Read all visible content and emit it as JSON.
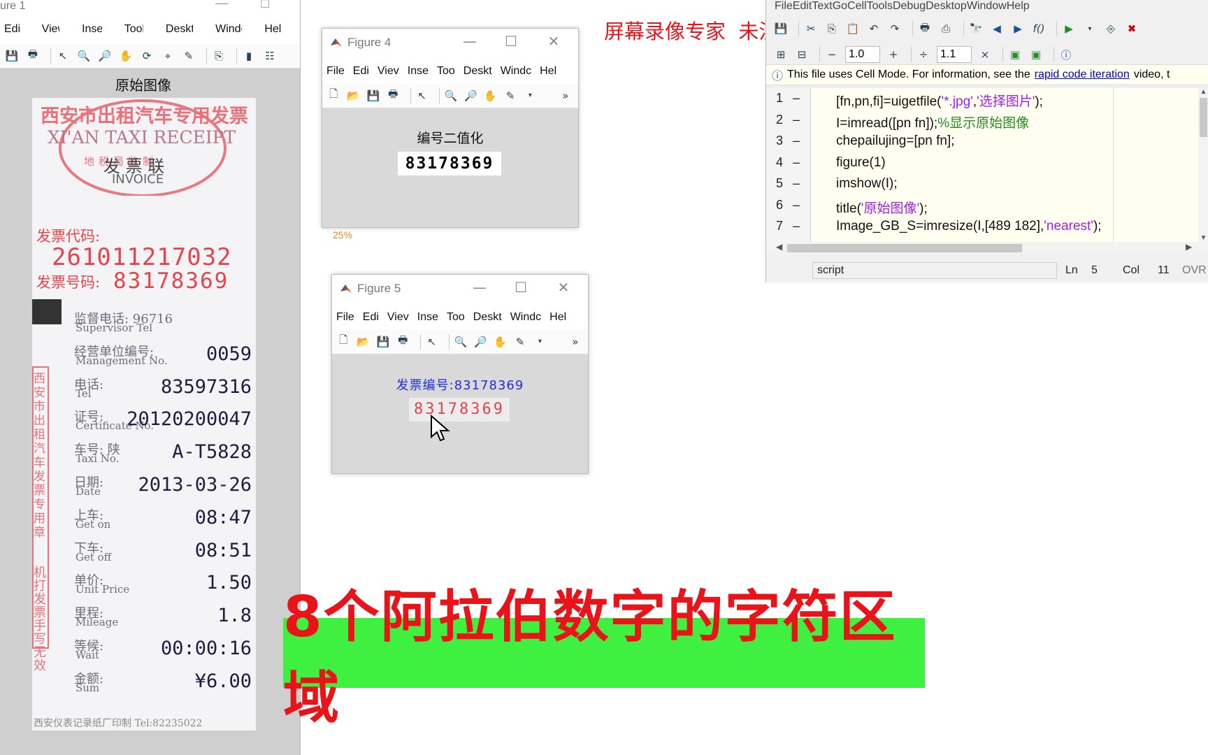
{
  "fig1": {
    "title": "ure 1",
    "menu": [
      "Edit",
      "View",
      "Insert",
      "Tools",
      "Desktop",
      "Window",
      "Help"
    ],
    "axes_title": "原始图像",
    "receipt": {
      "header_cn": "西安市出租汽车专用发票",
      "header_en": "XI'AN TAXI RECEIPT",
      "stamp_text": "地税局监制",
      "stub": "发 票 联",
      "invoice": "INVOICE",
      "code_label": "发票代码:",
      "code_value": "261011217032",
      "number_label": "发票号码:",
      "number_value": "83178369",
      "side_stamp": "西安市出租汽车发票专用章",
      "handwrite_note": "机打发票 手写无效",
      "footer": "西安仪表记录纸厂印制 Tel:82235022",
      "rows": [
        {
          "cn": "监督电话: 96716",
          "en": "Supervisor Tel",
          "value": ""
        },
        {
          "cn": "经营单位编号:",
          "en": "Management No.",
          "value": "0059"
        },
        {
          "cn": "电话:",
          "en": "Tel",
          "value": "83597316"
        },
        {
          "cn": "证号:",
          "en": "Certificate No.",
          "value": "20120200047"
        },
        {
          "cn": "车号: 陕",
          "en": "Taxi No.",
          "value": "A-T5828"
        },
        {
          "cn": "日期:",
          "en": "Date",
          "value": "2013-03-26"
        },
        {
          "cn": "上车:",
          "en": "Get on",
          "value": "08:47"
        },
        {
          "cn": "下车:",
          "en": "Get off",
          "value": "08:51"
        },
        {
          "cn": "单价:",
          "en": "Unit Price",
          "value": "1.50"
        },
        {
          "cn": "里程:",
          "en": "Mileage",
          "value": "1.8"
        },
        {
          "cn": "等候:",
          "en": "Wait",
          "value": "00:00:16"
        },
        {
          "cn": "金额:",
          "en": "Sum",
          "value": "¥6.00"
        }
      ]
    }
  },
  "fig4": {
    "title": "Figure 4",
    "menu": [
      "File",
      "Edi",
      "Viev",
      "Inse",
      "Too",
      "Deskt",
      "Windc",
      "Hel"
    ],
    "axes_title": "编号二值化",
    "image_text": "83178369"
  },
  "stray_label": "25%",
  "fig5": {
    "title": "Figure 5",
    "menu": [
      "File",
      "Edi",
      "Viev",
      "Inse",
      "Too",
      "Deskt",
      "Windc",
      "Hel"
    ],
    "axes_title": "发票编号:83178369",
    "image_text": "83178369"
  },
  "watermark": "屏幕录像专家  未注册",
  "editor": {
    "menu": [
      "File",
      "Edit",
      "Text",
      "Go",
      "Cell",
      "Tools",
      "Debug",
      "Desktop",
      "Window",
      "Help"
    ],
    "cell_minus_value": "1.0",
    "cell_div_value": "1.1",
    "info_text": "This file uses Cell Mode. For information, see the",
    "info_link": "rapid code iteration",
    "info_tail": "video, t",
    "lines": [
      {
        "n": "1",
        "parts": [
          [
            "[fn,pn,fi]=uigetfile(",
            ""
          ],
          [
            "'*.jpg'",
            "s"
          ],
          [
            ",",
            ""
          ],
          [
            "'选择图片'",
            "s"
          ],
          [
            ");",
            ""
          ]
        ]
      },
      {
        "n": "2",
        "parts": [
          [
            "I=imread([pn fn]);",
            ""
          ],
          [
            "%显示原始图像",
            "c"
          ]
        ]
      },
      {
        "n": "3",
        "parts": [
          [
            "chepailujing=[pn fn];",
            ""
          ]
        ]
      },
      {
        "n": "4",
        "parts": [
          [
            "figure(1)",
            ""
          ]
        ]
      },
      {
        "n": "5",
        "parts": [
          [
            "imshow(I);",
            ""
          ]
        ]
      },
      {
        "n": "6",
        "parts": [
          [
            "title(",
            ""
          ],
          [
            "'原始图像'",
            "s"
          ],
          [
            ");",
            ""
          ]
        ]
      },
      {
        "n": "7",
        "parts": [
          [
            "Image_GB_S=imresize(I,[489 182],",
            ""
          ],
          [
            "'nearest'",
            "s"
          ],
          [
            ");",
            ""
          ]
        ]
      }
    ],
    "status": {
      "mode": "script",
      "ln_label": "Ln",
      "ln": "5",
      "col_label": "Col",
      "col": "11",
      "ovr": "OVR"
    }
  },
  "banner": "8个阿拉伯数字的字符区域"
}
